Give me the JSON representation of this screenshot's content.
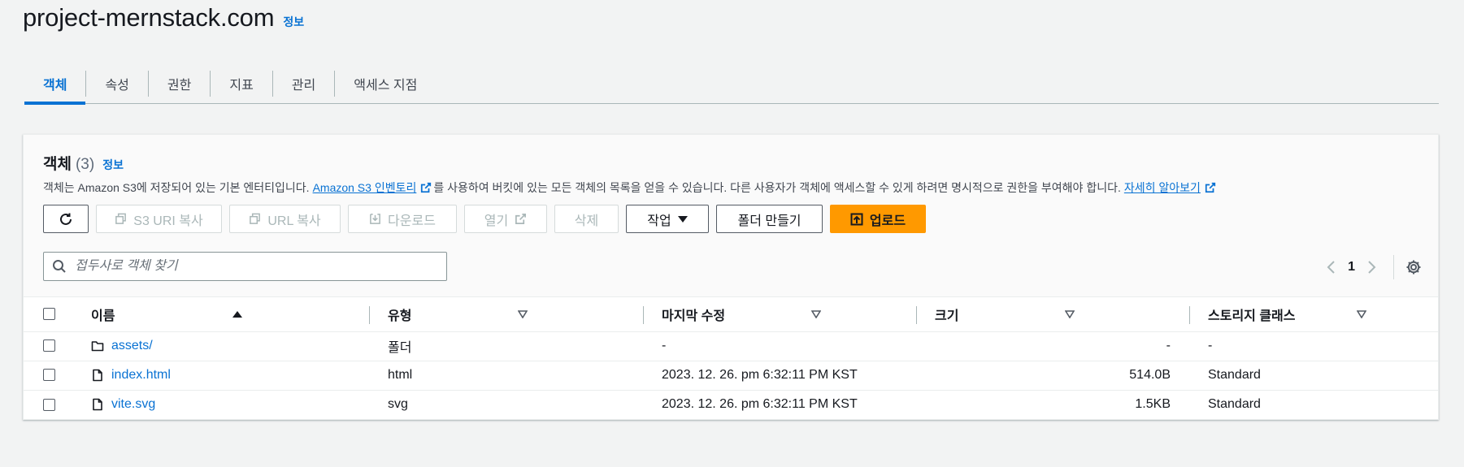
{
  "bucket": {
    "name": "project-mernstack.com",
    "info": "정보"
  },
  "tabs": [
    {
      "label": "객체",
      "active": true
    },
    {
      "label": "속성"
    },
    {
      "label": "권한"
    },
    {
      "label": "지표"
    },
    {
      "label": "관리"
    },
    {
      "label": "액세스 지점"
    }
  ],
  "objects": {
    "title": "객체",
    "count": "(3)",
    "info": "정보",
    "desc_1": "객체는 Amazon S3에 저장되어 있는 기본 엔터티입니다.",
    "inventory_link": "Amazon S3 인벤토리",
    "desc_2": "를 사용하여 버킷에 있는 모든 객체의 목록을 얻을 수 있습니다. 다른 사용자가 객체에 액세스할 수 있게 하려면 명시적으로 권한을 부여해야 합니다.",
    "learn_more": "자세히 알아보기"
  },
  "toolbar": {
    "copy_s3_uri": "S3 URI 복사",
    "copy_url": "URL 복사",
    "download": "다운로드",
    "open": "열기",
    "delete": "삭제",
    "actions": "작업",
    "create_folder": "폴더 만들기",
    "upload": "업로드"
  },
  "search": {
    "placeholder": "접두사로 객체 찾기"
  },
  "pager": {
    "page": "1"
  },
  "table": {
    "columns": {
      "name": "이름",
      "type": "유형",
      "modified": "마지막 수정",
      "size": "크기",
      "storage": "스토리지 클래스"
    },
    "rows": [
      {
        "name": "assets/",
        "icon": "folder-icon",
        "type": "폴더",
        "modified": "-",
        "size": "-",
        "storage": "-"
      },
      {
        "name": "index.html",
        "icon": "file-icon",
        "type": "html",
        "modified": "2023. 12. 26. pm 6:32:11 PM KST",
        "size": "514.0B",
        "storage": "Standard"
      },
      {
        "name": "vite.svg",
        "icon": "file-icon",
        "type": "svg",
        "modified": "2023. 12. 26. pm 6:32:11 PM KST",
        "size": "1.5KB",
        "storage": "Standard"
      }
    ]
  },
  "colors": {
    "accent": "#0972d3",
    "primary_button": "#ff9900"
  }
}
